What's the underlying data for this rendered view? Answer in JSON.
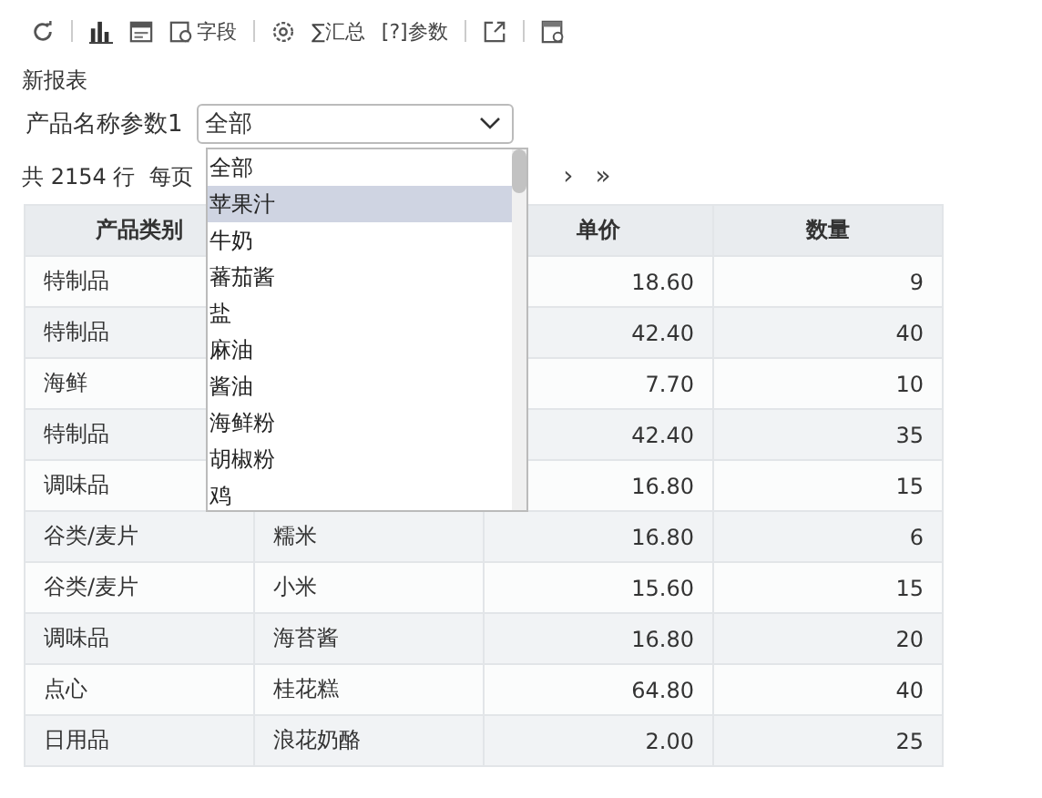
{
  "toolbar": [
    {
      "kind": "refresh"
    },
    {
      "kind": "separator"
    },
    {
      "kind": "chart"
    },
    {
      "kind": "form"
    },
    {
      "kind": "field",
      "label": "字段"
    },
    {
      "kind": "separator"
    },
    {
      "kind": "settings"
    },
    {
      "kind": "text",
      "label": "∑汇总"
    },
    {
      "kind": "text",
      "label": "[?]参数"
    },
    {
      "kind": "separator"
    },
    {
      "kind": "export"
    },
    {
      "kind": "separator"
    },
    {
      "kind": "sheet"
    }
  ],
  "report_title": "新报表",
  "parameter": {
    "label": "产品名称参数1",
    "value": "全部"
  },
  "pagination": {
    "total": "共 2154 行",
    "per_page": "每页",
    "next": "›",
    "last": "»"
  },
  "dropdown": {
    "options": [
      {
        "label": "全部",
        "selected": false
      },
      {
        "label": "苹果汁",
        "selected": true
      },
      {
        "label": "牛奶",
        "selected": false
      },
      {
        "label": "蕃茄酱",
        "selected": false
      },
      {
        "label": "盐",
        "selected": false
      },
      {
        "label": "麻油",
        "selected": false
      },
      {
        "label": "酱油",
        "selected": false
      },
      {
        "label": "海鲜粉",
        "selected": false
      },
      {
        "label": "胡椒粉",
        "selected": false
      },
      {
        "label": "鸡",
        "selected": false
      }
    ]
  },
  "table": {
    "columns": [
      "产品类别",
      null,
      "单价",
      "数量"
    ],
    "rows": [
      [
        "特制品",
        null,
        "18.60",
        "9"
      ],
      [
        "特制品",
        null,
        "42.40",
        "40"
      ],
      [
        "海鲜",
        null,
        "7.70",
        "10"
      ],
      [
        "特制品",
        null,
        "42.40",
        "35"
      ],
      [
        "调味品",
        null,
        "16.80",
        "15"
      ],
      [
        "谷类/麦片",
        "糯米",
        "16.80",
        "6"
      ],
      [
        "谷类/麦片",
        "小米",
        "15.60",
        "15"
      ],
      [
        "调味品",
        "海苔酱",
        "16.80",
        "20"
      ],
      [
        "点心",
        "桂花糕",
        "64.80",
        "40"
      ],
      [
        "日用品",
        "浪花奶酪",
        "2.00",
        "25"
      ]
    ]
  }
}
